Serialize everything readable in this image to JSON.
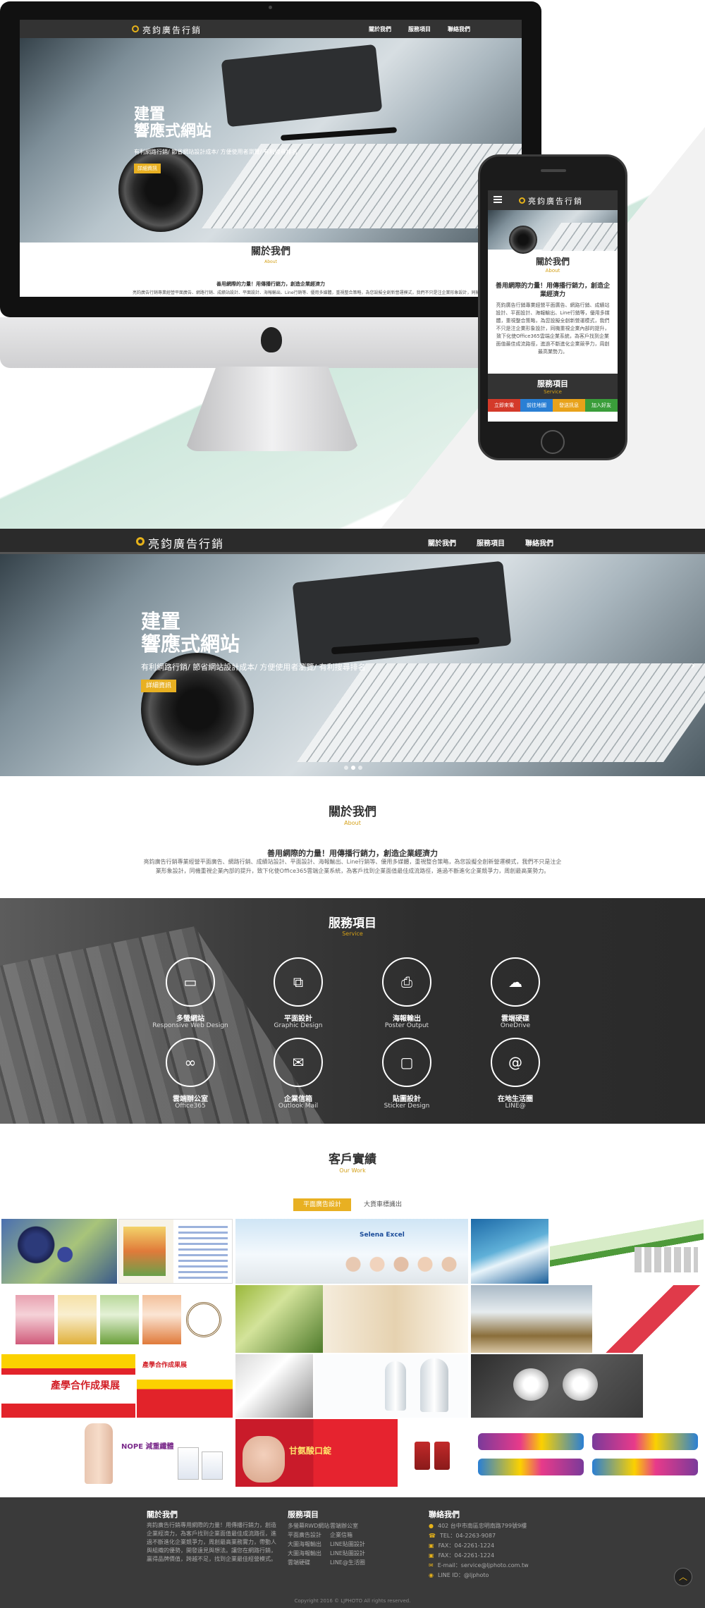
{
  "brand": {
    "name": "亮鈞廣告行銷"
  },
  "nav": {
    "items": [
      "關於我們",
      "服務項目",
      "聯絡我們"
    ]
  },
  "hero": {
    "title_line1": "建置",
    "title_line2": "響應式網站",
    "subtitle": "有利網路行銷/ 節省網站設計成本/ 方便使用者瀏覽/ 有利搜尋排名",
    "button": "詳細資訊"
  },
  "about": {
    "title": "關於我們",
    "en": "About",
    "headline": "善用網際的力量！用傳播行銷力，創造企業經濟力",
    "body": "亮鈞廣告行銷專業經營平面廣告、網路行銷、成績站設計、平面設計、海報輸出、Line行銷等、優用多媒體，重視整合策略，為您設擬全創新營運模式，我們不只是注企業形象設計，同機重視企業內部的提升，致下化使Office365雲端企業系統，為客戶找到企業面值最佳成流路徑，進過不斷進化企業競爭力，周創最高業勢力。"
  },
  "mobile": {
    "about_title": "關於我們",
    "about_en": "About",
    "headline": "善用網際的力量！用傳播行銷力，創造企業經濟力",
    "body": "亮鈞廣告行銷專業經營平面廣告、網路行銷、成績站設計、平面設計、海報輸出、Line行銷等，優用多媒體，重視整合策略，為您設擬全創新營運模式，我們不只是注企業形象設計，同機重視企業內部的提升，致下化使Office365雲端企業系統，為客戶找到企業面值最佳成流路徑，進過不斷進化企業競爭力，周創最高業勢力。",
    "services_title": "服務項目",
    "services_en": "Service",
    "buttons": [
      "立即來電",
      "前往地圖",
      "發送訊息",
      "加入好友"
    ]
  },
  "services": {
    "title": "服務項目",
    "en": "Service",
    "items": [
      {
        "icon": "monitor-icon",
        "title": "多螢網站",
        "en": "Responsive Web Design"
      },
      {
        "icon": "design-icon",
        "title": "平面設計",
        "en": "Graphic Design"
      },
      {
        "icon": "printer-icon",
        "title": "海報輸出",
        "en": "Poster Output"
      },
      {
        "icon": "cloud-icon",
        "title": "雲端硬碟",
        "en": "OneDrive"
      },
      {
        "icon": "link-icon",
        "title": "雲端辦公室",
        "en": "Office365"
      },
      {
        "icon": "mail-icon",
        "title": "企業信箱",
        "en": "Outlook Mail"
      },
      {
        "icon": "sticker-icon",
        "title": "貼圖設計",
        "en": "Sticker Design"
      },
      {
        "icon": "at-icon",
        "title": "在地生活圈",
        "en": "LINE@"
      }
    ]
  },
  "works": {
    "title": "客戶實績",
    "en": "Our Work",
    "filters": [
      "平面廣告設計",
      "大貨車標識出"
    ],
    "tile_texts": {
      "t3": "Selena Excel",
      "t9": "產學合作成果展",
      "t10": "產學合作成果展",
      "t14": "NOPE 減重纖體",
      "t16": "甘氨酸口錠"
    }
  },
  "footer": {
    "about_title": "關於我們",
    "about_text": "亮鈞廣告行銷專用網際的力量！用傳播行銷力，創造企業經濟力，為客戶找到企業面值最佳成流路徑，進過不斷進化企業競爭力，周創最高業務實力，帶動人與組織的優勢，開發遠見與想法。讓您在網路行銷，贏得品牌價值，跨越不足，找到企業最佳經營模式。",
    "services_title": "服務項目",
    "services_col1": [
      "多螢幕RWD網站",
      "平面廣告設計",
      "大圖海報輸出",
      "大圖海報輸出",
      "雲端硬碟"
    ],
    "services_col2": [
      "雲端辦公室",
      "企業信箱",
      "LINE貼圖設計",
      "LINE貼圖設計",
      "LINE@生活圈"
    ],
    "contact_title": "聯絡我們",
    "contact": [
      {
        "icon": "pin-icon",
        "text": "402 台中市南區忠明南路799號9樓"
      },
      {
        "icon": "phone-icon",
        "text": "TEL：04-2263-9087"
      },
      {
        "icon": "fax-icon",
        "text": "FAX：04-2261-1224"
      },
      {
        "icon": "fax-icon",
        "text": "FAX：04-2261-1224"
      },
      {
        "icon": "mail-icon",
        "text": "E-mail：service@ljphoto.com.tw"
      },
      {
        "icon": "line-icon",
        "text": "LINE ID：@ljphoto"
      }
    ],
    "copyright": "Copyright 2016 © LJPHOTO All rights reserved."
  },
  "colors": {
    "accent": "#e6b21a",
    "dark": "#2b2b2b",
    "green": "#3a9d3a",
    "blue": "#2a7fd4",
    "red": "#d43a2a"
  }
}
